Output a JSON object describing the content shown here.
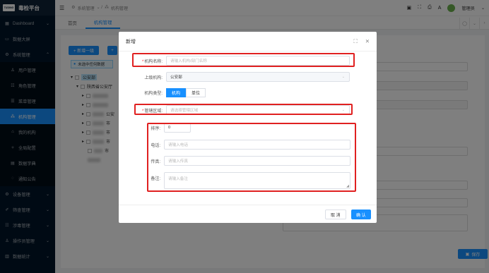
{
  "app": {
    "logo_text": "TUDING",
    "title": "毒检平台"
  },
  "sidebar": {
    "items": [
      {
        "icon": "▦",
        "label": "Dashboard",
        "arrow": "⌄"
      },
      {
        "icon": "▭",
        "label": "数据大屏"
      },
      {
        "icon": "⚙",
        "label": "系统管理",
        "arrow": "⌃"
      },
      {
        "icon": "♙",
        "label": "用户管理"
      },
      {
        "icon": "☷",
        "label": "角色管理"
      },
      {
        "icon": "☰",
        "label": "菜单管理"
      },
      {
        "icon": "⁂",
        "label": "机构管理"
      },
      {
        "icon": "⌂",
        "label": "我的机构"
      },
      {
        "icon": "✧",
        "label": "全局配置"
      },
      {
        "icon": "▤",
        "label": "数据字典"
      },
      {
        "icon": "◌",
        "label": "通知公告"
      },
      {
        "icon": "⚙",
        "label": "设备管理",
        "arrow": "⌄"
      },
      {
        "icon": "✐",
        "label": "筛查管理",
        "arrow": "⌄"
      },
      {
        "icon": "☷",
        "label": "涉毒管理",
        "arrow": "⌄"
      },
      {
        "icon": "♙",
        "label": "操作员管理",
        "arrow": "⌄"
      },
      {
        "icon": "▥",
        "label": "数据统计",
        "arrow": "⌄"
      }
    ]
  },
  "topbar": {
    "menu_icon": "☰",
    "crumb_icon": "⚙",
    "crumb_1": "系统管理",
    "crumb_sep_1": "⌄ /",
    "crumb_2_icon": "⁂",
    "crumb_2": "机构管理",
    "tool_icons": [
      "▣",
      "⛶",
      "⎙",
      "A"
    ],
    "user": "管理员",
    "user_chevron": "⌄"
  },
  "tabs": {
    "items": [
      "首页",
      "机构管理"
    ],
    "tools": [
      "◯",
      "⌄",
      "›"
    ]
  },
  "page": {
    "btn_add_top": "+ 新增一级",
    "tip_icon": "●",
    "tip_text": "未选中任何数据",
    "tree_root": "公安部",
    "tree_child": "陕西省公安厅",
    "tree_suffix_1": "公安",
    "tree_suffix_2": "市",
    "tree_suffix_3": "市",
    "tree_suffix_4": "市",
    "tree_suffix_5": "市",
    "save_icon": "▣",
    "save_label": "保存"
  },
  "dialog": {
    "title": "新增",
    "fullscreen_icon": "⛶",
    "close_icon": "✕",
    "org_name": {
      "label": "机构名称:",
      "placeholder": "请输入机构/部门名称"
    },
    "parent": {
      "label": "上级机构:",
      "value": "公安部"
    },
    "type": {
      "label": "机构类型:",
      "options": [
        "机构",
        "单位"
      ],
      "selected": 0
    },
    "region": {
      "label": "管辖区域:",
      "placeholder": "请选择管辖区域"
    },
    "sort": {
      "label": "排序:",
      "value": "0"
    },
    "phone": {
      "label": "电话:",
      "placeholder": "请输入电话"
    },
    "fax": {
      "label": "传真:",
      "placeholder": "请输入传真"
    },
    "remark": {
      "label": "备注:",
      "placeholder": "请输入备注"
    },
    "cancel_label": "取 消",
    "confirm_label": "确 认"
  }
}
